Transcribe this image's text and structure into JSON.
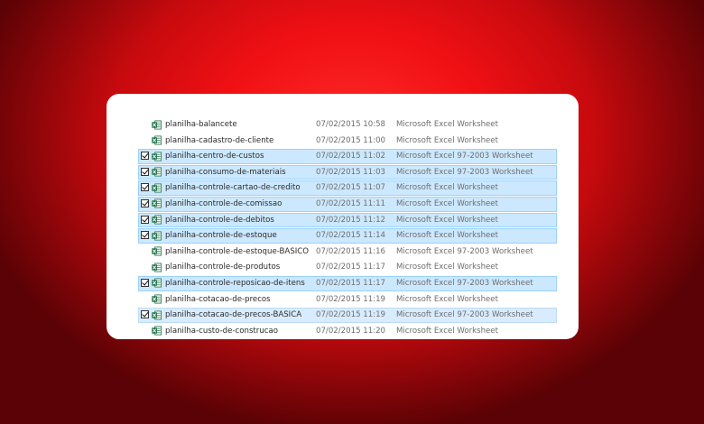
{
  "files": [
    {
      "name": "planilha-balancete",
      "date": "07/02/2015 10:58",
      "type": "Microsoft Excel Worksheet",
      "checked": false,
      "selected": false
    },
    {
      "name": "planilha-cadastro-de-cliente",
      "date": "07/02/2015 11:00",
      "type": "Microsoft Excel Worksheet",
      "checked": false,
      "selected": false
    },
    {
      "name": "planilha-centro-de-custos",
      "date": "07/02/2015 11:02",
      "type": "Microsoft Excel 97-2003 Worksheet",
      "checked": true,
      "selected": true
    },
    {
      "name": "planilha-consumo-de-materiais",
      "date": "07/02/2015 11:03",
      "type": "Microsoft Excel 97-2003 Worksheet",
      "checked": true,
      "selected": true
    },
    {
      "name": "planilha-controle-cartao-de-credito",
      "date": "07/02/2015 11:07",
      "type": "Microsoft Excel Worksheet",
      "checked": true,
      "selected": true
    },
    {
      "name": "planilha-controle-de-comissao",
      "date": "07/02/2015 11:11",
      "type": "Microsoft Excel Worksheet",
      "checked": true,
      "selected": true
    },
    {
      "name": "planilha-controle-de-debitos",
      "date": "07/02/2015 11:12",
      "type": "Microsoft Excel Worksheet",
      "checked": true,
      "selected": true
    },
    {
      "name": "planilha-controle-de-estoque",
      "date": "07/02/2015 11:14",
      "type": "Microsoft Excel Worksheet",
      "checked": true,
      "selected": true
    },
    {
      "name": "planilha-controle-de-estoque-BASICO",
      "date": "07/02/2015 11:16",
      "type": "Microsoft Excel 97-2003 Worksheet",
      "checked": false,
      "selected": false
    },
    {
      "name": "planilha-controle-de-produtos",
      "date": "07/02/2015 11:17",
      "type": "Microsoft Excel Worksheet",
      "checked": false,
      "selected": false
    },
    {
      "name": "planilha-controle-reposicao-de-itens",
      "date": "07/02/2015 11:17",
      "type": "Microsoft Excel 97-2003 Worksheet",
      "checked": true,
      "selected": true
    },
    {
      "name": "planilha-cotacao-de-precos",
      "date": "07/02/2015 11:19",
      "type": "Microsoft Excel Worksheet",
      "checked": false,
      "selected": false
    },
    {
      "name": "planilha-cotacao-de-precos-BASICA",
      "date": "07/02/2015 11:19",
      "type": "Microsoft Excel 97-2003 Worksheet",
      "checked": true,
      "selected": true,
      "focused": true
    },
    {
      "name": "planilha-custo-de-construcao",
      "date": "07/02/2015 11:20",
      "type": "Microsoft Excel Worksheet",
      "checked": false,
      "selected": false
    }
  ],
  "icon": "excel-file-icon",
  "colors": {
    "background": "#e3101a",
    "selection": "#cce8ff",
    "selection_border": "#99d1ff",
    "excel_green": "#1e7145"
  }
}
